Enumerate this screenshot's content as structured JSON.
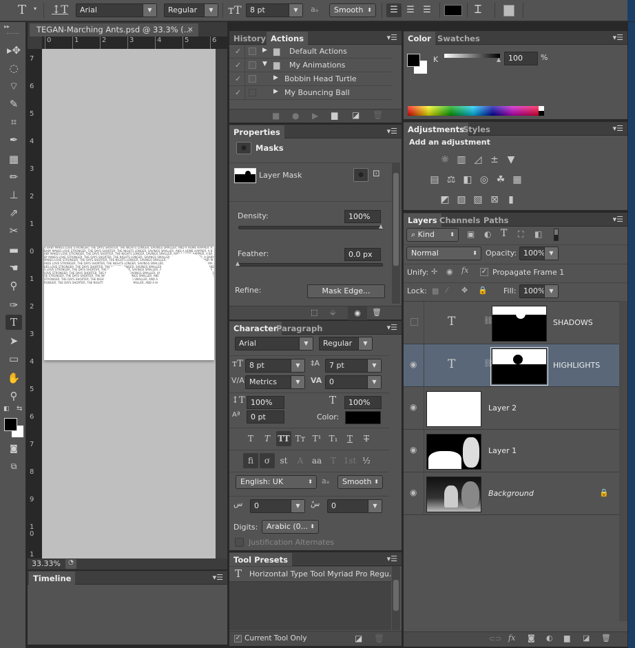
{
  "options_bar": {
    "tool_icon": "type-tool-icon",
    "orientation_icon": "toggle-orientation-icon",
    "font_family": "Arial",
    "font_style": "Regular",
    "font_size": "8 pt",
    "aa_label": "aₐ",
    "anti_alias": "Smooth",
    "align": [
      "align-left",
      "align-center",
      "align-right"
    ],
    "text_color": "#000000",
    "warp_icon": "warp-text-icon",
    "char_panel_icon": "character-panel-icon"
  },
  "document": {
    "tab_title": "TEGAN-Marching Ants.psd @ 33.3% (...",
    "close": "×",
    "zoom": "33.33%",
    "ruler_h": [
      "0",
      "1",
      "2",
      "3",
      "4",
      "5",
      "6"
    ],
    "ruler_v": [
      "7",
      "6",
      "5",
      "4",
      "3",
      "2",
      "1",
      "0",
      "1",
      "2",
      "3",
      "4",
      "5",
      "6",
      "7",
      "8",
      "9",
      "1 0",
      "1"
    ],
    "canvas_text": "A BABY MAKES LOVE STRONGER, THE DAYS SHORTER, THE NIGHTS LONGER, SAVINGS SMALLER, AND A HOME HAPPIER. A BABY MAKES LOVE STRONGER, THE DAYS SHORTER, THE NIGHTS LONGER, SAVINGS SMALLER, AND A HOME HAPPIER."
  },
  "timeline": {
    "tab": "Timeline"
  },
  "actions_panel": {
    "tabs": [
      "History",
      "Actions"
    ],
    "active_tab": "Actions",
    "items": [
      {
        "label": "Default Actions",
        "type": "set",
        "expanded": false,
        "checked": true,
        "dialog": true
      },
      {
        "label": "My Animations",
        "type": "set",
        "expanded": true,
        "checked": true,
        "dialog": true
      },
      {
        "label": "Bobbin Head Turtle",
        "type": "action",
        "checked": true,
        "dialog": true
      },
      {
        "label": "My Bouncing Ball",
        "type": "action",
        "checked": true,
        "dialog": false
      }
    ],
    "footer": [
      "stop-icon",
      "record-icon",
      "play-icon",
      "folder-icon",
      "new-action-icon",
      "trash-icon"
    ]
  },
  "properties_panel": {
    "tab": "Properties",
    "section": "Masks",
    "mask_label": "Layer Mask",
    "density_label": "Density:",
    "density_value": "100%",
    "density_fraction": 1.0,
    "feather_label": "Feather:",
    "feather_value": "0.0 px",
    "feather_fraction": 0.0,
    "refine_label": "Refine:",
    "mask_edge_button": "Mask Edge..."
  },
  "character_panel": {
    "tabs": [
      "Character",
      "Paragraph"
    ],
    "font_family": "Arial",
    "font_style": "Regular",
    "size": "8 pt",
    "leading": "7 pt",
    "kerning": "Metrics",
    "tracking": "0",
    "vertical_scale": "100%",
    "horizontal_scale": "100%",
    "baseline_shift": "0 pt",
    "color_label": "Color:",
    "color": "#000000",
    "style_buttons": [
      "T",
      "T",
      "TT",
      "Tт",
      "T¹",
      "T₁",
      "T",
      "T"
    ],
    "opentype_buttons": [
      "fi",
      "σ",
      "st",
      "A",
      "aa",
      "T",
      "1st",
      "½"
    ],
    "language": "English: UK",
    "aa_label": "aₐ",
    "anti_alias": "Smooth",
    "kashida_1": "0",
    "kashida_2": "0",
    "digits_label": "Digits:",
    "digits_value": "Arabic (0...",
    "justification_alternates": "Justification Alternates"
  },
  "tool_presets": {
    "tab": "Tool Presets",
    "items": [
      "Horizontal Type Tool Myriad Pro Regu..."
    ],
    "current_tool_only": "Current Tool Only",
    "current_tool_only_checked": true
  },
  "color_panel": {
    "tabs": [
      "Color",
      "Swatches"
    ],
    "channel": "K",
    "value": "100",
    "unit": "%",
    "k_fraction": 1.0,
    "foreground": "#000000",
    "background": "#ffffff"
  },
  "adjustments_panel": {
    "tabs": [
      "Adjustments",
      "Styles"
    ],
    "heading": "Add an adjustment",
    "rows": [
      [
        "brightness-contrast-icon",
        "levels-icon",
        "curves-icon",
        "exposure-icon",
        "vibrance-icon"
      ],
      [
        "hue-saturation-icon",
        "color-balance-icon",
        "black-white-icon",
        "photo-filter-icon",
        "channel-mixer-icon",
        "color-lookup-icon"
      ],
      [
        "invert-icon",
        "posterize-icon",
        "threshold-icon",
        "selective-color-icon",
        "gradient-map-icon"
      ]
    ]
  },
  "layers_panel": {
    "tabs": [
      "Layers",
      "Channels",
      "Paths"
    ],
    "filter": "Kind",
    "blend_mode": "Normal",
    "opacity_label": "Opacity:",
    "opacity": "100%",
    "unify_label": "Unify:",
    "propagate": "Propagate Frame 1",
    "lock_label": "Lock:",
    "fill_label": "Fill:",
    "fill": "100%",
    "layers": [
      {
        "name": "SHADOWS",
        "type": "text",
        "visible": false,
        "selected": false,
        "has_mask": true
      },
      {
        "name": "HIGHLIGHTS",
        "type": "text",
        "visible": true,
        "selected": true,
        "has_mask": true
      },
      {
        "name": "Layer 2",
        "type": "pixel",
        "visible": true,
        "selected": false
      },
      {
        "name": "Layer 1",
        "type": "pixel",
        "visible": true,
        "selected": false
      },
      {
        "name": "Background",
        "type": "background",
        "visible": true,
        "selected": false,
        "locked": true
      }
    ],
    "footer": [
      "link-icon",
      "fx-icon",
      "add-mask-icon",
      "adjustment-layer-icon",
      "group-icon",
      "new-layer-icon",
      "trash-icon"
    ]
  },
  "colors": {
    "panel_bg": "#535353",
    "selected_layer": "#596779",
    "tab_bar": "#3e3e3e"
  }
}
